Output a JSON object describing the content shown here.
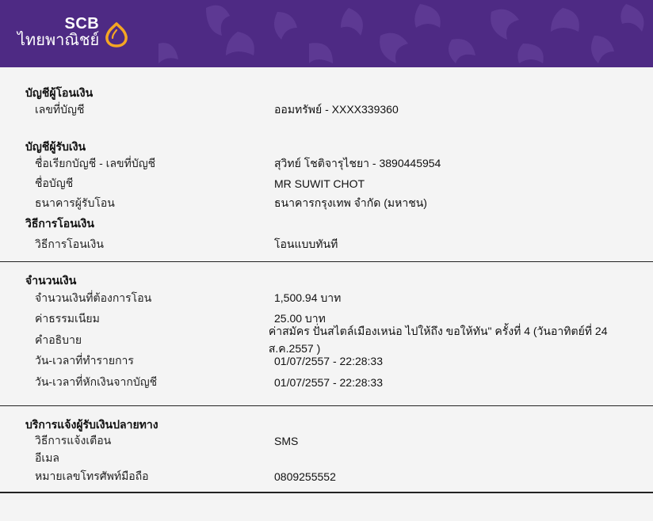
{
  "header": {
    "logo_en": "SCB",
    "logo_th": "ไทยพาณิชย์",
    "logo_icon": "scb-mark-icon",
    "bg_color": "#4e2a84",
    "accent_color": "#f5a623"
  },
  "from_account": {
    "title": "บัญชีผู้โอนเงิน",
    "rows": [
      {
        "label": "เลขที่บัญชี",
        "value": "ออมทรัพย์ - XXXX339360"
      }
    ]
  },
  "to_account": {
    "title": "บัญชีผู้รับเงิน",
    "rows": [
      {
        "label": "ชื่อเรียกบัญชี - เลขที่บัญชี",
        "value": "สุวิทย์ โชติจารุไชยา - 3890445954"
      },
      {
        "label": "ชื่อบัญชี",
        "value": "MR SUWIT CHOT"
      },
      {
        "label": "ธนาคารผู้รับโอน",
        "value": "ธนาคารกรุงเทพ จำกัด (มหาชน)"
      }
    ]
  },
  "method": {
    "title": "วิธีการโอนเงิน",
    "rows": [
      {
        "label": "วิธีการโอนเงิน",
        "value": "โอนแบบทันที"
      }
    ]
  },
  "amount": {
    "title": "จำนวนเงิน",
    "rows": [
      {
        "label": "จำนวนเงินที่ต้องการโอน",
        "value": "1,500.94 บาท"
      },
      {
        "label": "ค่าธรรมเนียม",
        "value": "25.00  บาท"
      },
      {
        "label": "คำอธิบาย",
        "value": "ค่าสมัคร ปั่นสไตล์เมืองเหน่อ ไปให้ถึง ขอให้ทัน\" ครั้งที่ 4 (วันอาทิตย์ที่ 24 ส.ค.2557 )"
      },
      {
        "label": "วัน-เวลาที่ทำรายการ",
        "value": "01/07/2557 - 22:28:33"
      },
      {
        "label": "วัน-เวลาที่หักเงินจากบัญชี",
        "value": "01/07/2557 - 22:28:33"
      }
    ]
  },
  "notify": {
    "title": "บริการแจ้งผู้รับเงินปลายทาง",
    "rows": [
      {
        "label": "วิธีการแจ้งเตือน",
        "value": "SMS"
      },
      {
        "label": "อีเมล",
        "value": ""
      },
      {
        "label": "หมายเลขโทรศัพท์มือถือ",
        "value": "0809255552"
      }
    ]
  }
}
